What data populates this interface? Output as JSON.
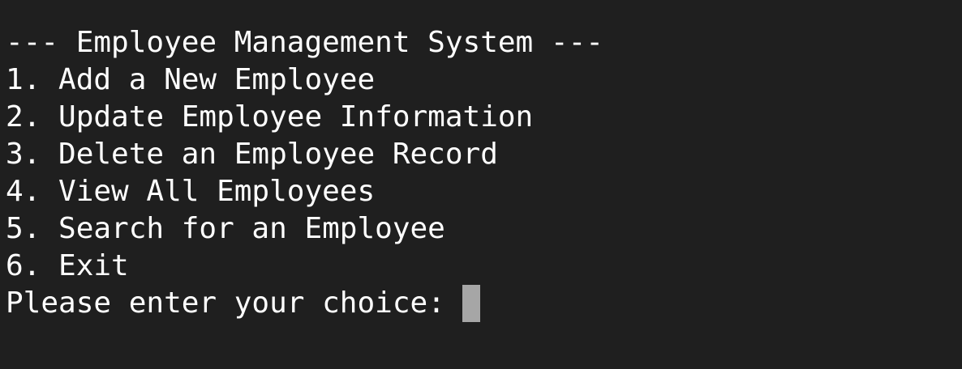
{
  "terminal": {
    "header": "--- Employee Management System ---",
    "menu": [
      "1. Add a New Employee",
      "2. Update Employee Information",
      "3. Delete an Employee Record",
      "4. View All Employees",
      "5. Search for an Employee",
      "6. Exit"
    ],
    "prompt": "Please enter your choice:",
    "input_value": ""
  },
  "colors": {
    "background": "#1f1f1f",
    "text": "#ffffff",
    "cursor": "#a6a6a6"
  }
}
